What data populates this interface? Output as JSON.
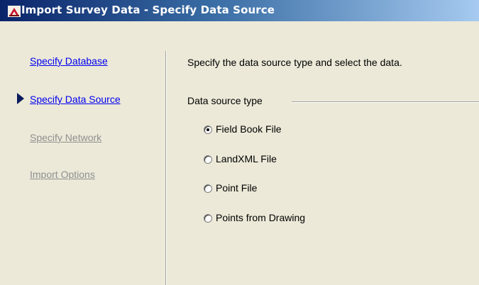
{
  "window": {
    "title": "Import Survey Data - Specify Data Source"
  },
  "sidebar": {
    "items": [
      {
        "label": "Specify Database",
        "enabled": true,
        "active": false
      },
      {
        "label": "Specify Data Source",
        "enabled": true,
        "active": true
      },
      {
        "label": "Specify Network",
        "enabled": false,
        "active": false
      },
      {
        "label": "Import Options",
        "enabled": false,
        "active": false
      }
    ]
  },
  "content": {
    "instruction": "Specify the data source type and select the data.",
    "group_label": "Data source type",
    "options": [
      {
        "label": "Field Book File",
        "selected": true
      },
      {
        "label": "LandXML File",
        "selected": false
      },
      {
        "label": "Point File",
        "selected": false
      },
      {
        "label": "Points from Drawing",
        "selected": false
      }
    ]
  },
  "colors": {
    "link": "#0000ee",
    "disabled_link": "#8f8f8f",
    "dialog_background": "#ece9d8",
    "titlebar_start": "#0a246a",
    "titlebar_end": "#a6caf0"
  }
}
